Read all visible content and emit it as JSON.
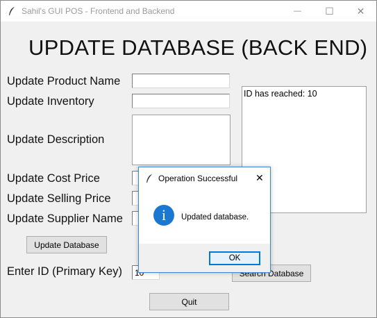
{
  "window": {
    "title": "Sahil's GUI POS - Frontend and Backend",
    "minimize_glyph": "—",
    "maximize_glyph": "☐",
    "close_glyph": "✕"
  },
  "heading": "UPDATE DATABASE (BACK END)",
  "form": {
    "product_name_label": "Update Product Name",
    "product_name_value": "",
    "inventory_label": "Update Inventory",
    "inventory_value": "",
    "description_label": "Update Description",
    "description_value": "",
    "cost_price_label": "Update Cost Price",
    "selling_price_label": "Update Selling Price",
    "supplier_label": "Update Supplier Name",
    "update_button": "Update Database",
    "id_label": "Enter ID (Primary Key)",
    "id_value": "10",
    "search_button": "Search Database",
    "quit_button": "Quit"
  },
  "info_box": {
    "text": "ID has reached: 10"
  },
  "dialog": {
    "title": "Operation Successful",
    "close_glyph": "✕",
    "icon": "info-icon",
    "icon_glyph": "i",
    "message": "Updated database.",
    "ok_button": "OK"
  },
  "colors": {
    "accent": "#0078d7",
    "info_icon": "#1a78d3",
    "background": "#f0f0f0"
  }
}
